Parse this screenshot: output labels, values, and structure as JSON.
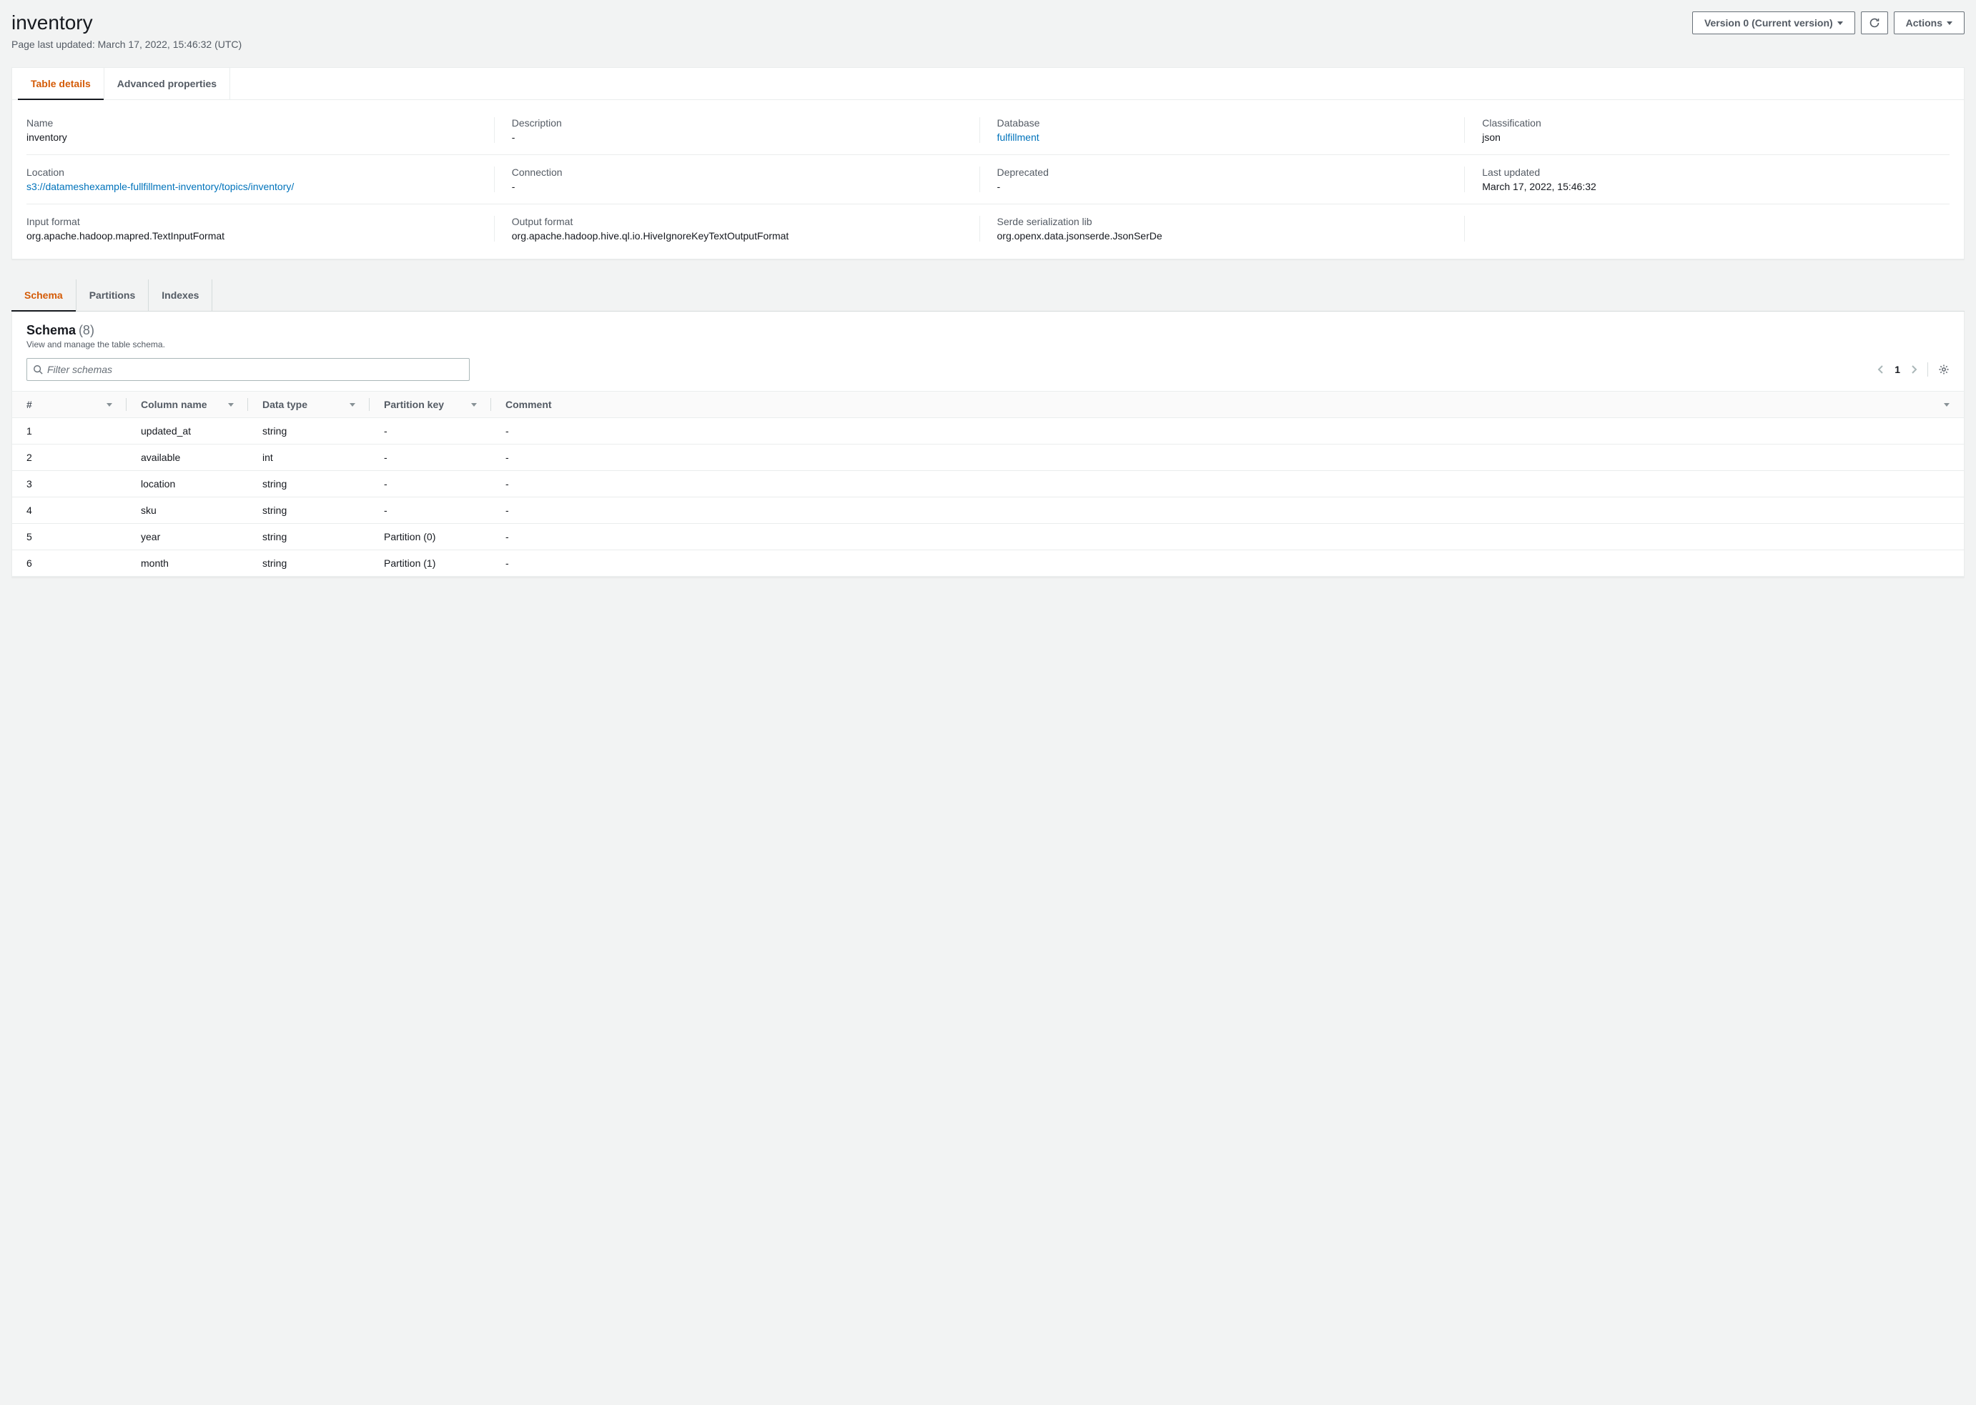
{
  "header": {
    "title": "inventory",
    "subtitle": "Page last updated: March 17, 2022, 15:46:32 (UTC)",
    "version_label": "Version 0 (Current version)",
    "actions_label": "Actions"
  },
  "tabs_top": {
    "table_details": "Table details",
    "advanced_properties": "Advanced properties"
  },
  "details": {
    "row1": {
      "name_label": "Name",
      "name_value": "inventory",
      "description_label": "Description",
      "description_value": "-",
      "database_label": "Database",
      "database_value": "fulfillment",
      "classification_label": "Classification",
      "classification_value": "json"
    },
    "row2": {
      "location_label": "Location",
      "location_value": "s3://datameshexample-fullfillment-inventory/topics/inventory/",
      "connection_label": "Connection",
      "connection_value": "-",
      "deprecated_label": "Deprecated",
      "deprecated_value": "-",
      "last_updated_label": "Last updated",
      "last_updated_value": "March 17, 2022, 15:46:32"
    },
    "row3": {
      "input_format_label": "Input format",
      "input_format_value": "org.apache.hadoop.mapred.TextInputFormat",
      "output_format_label": "Output format",
      "output_format_value": "org.apache.hadoop.hive.ql.io.HiveIgnoreKeyTextOutputFormat",
      "serde_label": "Serde serialization lib",
      "serde_value": "org.openx.data.jsonserde.JsonSerDe"
    }
  },
  "tabs_schema": {
    "schema": "Schema",
    "partitions": "Partitions",
    "indexes": "Indexes"
  },
  "schema": {
    "title": "Schema",
    "count": "(8)",
    "description": "View and manage the table schema.",
    "filter_placeholder": "Filter schemas",
    "page": "1",
    "columns": {
      "num": "#",
      "name": "Column name",
      "type": "Data type",
      "partition": "Partition key",
      "comment": "Comment"
    },
    "rows": [
      {
        "num": "1",
        "name": "updated_at",
        "type": "string",
        "partition": "-",
        "comment": "-"
      },
      {
        "num": "2",
        "name": "available",
        "type": "int",
        "partition": "-",
        "comment": "-"
      },
      {
        "num": "3",
        "name": "location",
        "type": "string",
        "partition": "-",
        "comment": "-"
      },
      {
        "num": "4",
        "name": "sku",
        "type": "string",
        "partition": "-",
        "comment": "-"
      },
      {
        "num": "5",
        "name": "year",
        "type": "string",
        "partition": "Partition (0)",
        "comment": "-"
      },
      {
        "num": "6",
        "name": "month",
        "type": "string",
        "partition": "Partition (1)",
        "comment": "-"
      }
    ]
  }
}
